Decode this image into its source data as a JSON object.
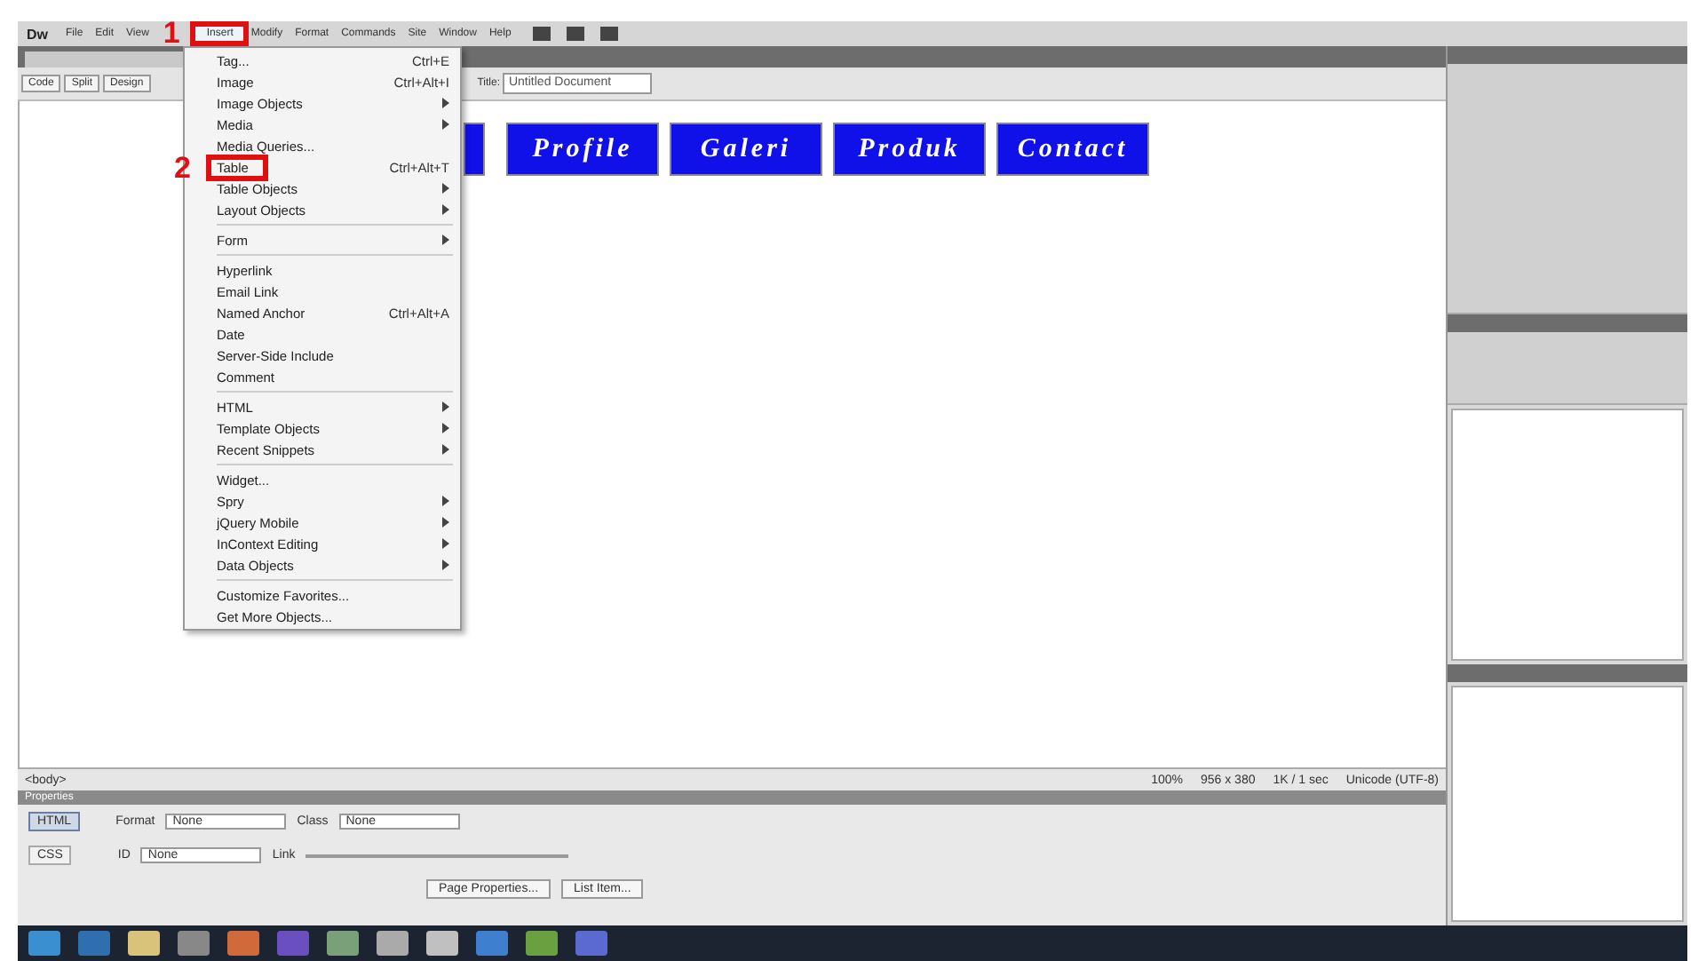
{
  "menubar": {
    "logo": "Dw",
    "items": [
      {
        "label": "File",
        "selected": false
      },
      {
        "label": "Edit",
        "selected": false
      },
      {
        "label": "View",
        "selected": false
      },
      {
        "label": "Insert",
        "selected": true,
        "annotation": "1"
      },
      {
        "label": "Modify",
        "selected": false
      },
      {
        "label": "Format",
        "selected": false
      },
      {
        "label": "Commands",
        "selected": false
      },
      {
        "label": "Site",
        "selected": false
      },
      {
        "label": "Window",
        "selected": false
      },
      {
        "label": "Help",
        "selected": false
      }
    ]
  },
  "document": {
    "view_buttons": [
      "Code",
      "Split",
      "Design"
    ],
    "title_label": "Title:",
    "title_value": "Untitled Document"
  },
  "page": {
    "nav_buttons": [
      "Profile",
      "Galeri",
      "Produk",
      "Contact"
    ]
  },
  "insert_menu": {
    "items": [
      {
        "kind": "item",
        "label": "Tag...",
        "shortcut": "Ctrl+E",
        "submenu": false
      },
      {
        "kind": "item",
        "label": "Image",
        "shortcut": "Ctrl+Alt+I",
        "submenu": false
      },
      {
        "kind": "item",
        "label": "Image Objects",
        "submenu": true
      },
      {
        "kind": "item",
        "label": "Media",
        "submenu": true
      },
      {
        "kind": "item",
        "label": "Media Queries...",
        "submenu": false
      },
      {
        "kind": "item",
        "label": "Table",
        "shortcut": "Ctrl+Alt+T",
        "submenu": false,
        "annotation": "2"
      },
      {
        "kind": "item",
        "label": "Table Objects",
        "submenu": true
      },
      {
        "kind": "item",
        "label": "Layout Objects",
        "submenu": true
      },
      {
        "kind": "separator"
      },
      {
        "kind": "item",
        "label": "Form",
        "submenu": true
      },
      {
        "kind": "separator"
      },
      {
        "kind": "item",
        "label": "Hyperlink",
        "submenu": false
      },
      {
        "kind": "item",
        "label": "Email Link",
        "submenu": false
      },
      {
        "kind": "item",
        "label": "Named Anchor",
        "shortcut": "Ctrl+Alt+A",
        "submenu": false
      },
      {
        "kind": "item",
        "label": "Date",
        "submenu": false
      },
      {
        "kind": "item",
        "label": "Server-Side Include",
        "submenu": false
      },
      {
        "kind": "item",
        "label": "Comment",
        "submenu": false
      },
      {
        "kind": "separator"
      },
      {
        "kind": "item",
        "label": "HTML",
        "submenu": true
      },
      {
        "kind": "item",
        "label": "Template Objects",
        "submenu": true
      },
      {
        "kind": "item",
        "label": "Recent Snippets",
        "submenu": true
      },
      {
        "kind": "separator"
      },
      {
        "kind": "item",
        "label": "Widget...",
        "submenu": false
      },
      {
        "kind": "item",
        "label": "Spry",
        "submenu": true
      },
      {
        "kind": "item",
        "label": "jQuery Mobile",
        "submenu": true
      },
      {
        "kind": "item",
        "label": "InContext Editing",
        "submenu": true
      },
      {
        "kind": "item",
        "label": "Data Objects",
        "submenu": true
      },
      {
        "kind": "separator"
      },
      {
        "kind": "item",
        "label": "Customize Favorites...",
        "submenu": false
      },
      {
        "kind": "item",
        "label": "Get More Objects...",
        "submenu": false
      }
    ]
  },
  "status_bar": {
    "tag": "<body>",
    "zoom": "100%",
    "size": "956 x 380",
    "download": "1K / 1 sec",
    "encoding": "Unicode (UTF-8)"
  },
  "properties": {
    "title": "Properties",
    "modes": [
      {
        "label": "HTML",
        "selected": true
      },
      {
        "label": "CSS",
        "selected": false
      }
    ],
    "format_label": "Format",
    "format_value": "None",
    "class_label": "Class",
    "class_value": "None",
    "id_label": "ID",
    "id_value": "None",
    "link_label": "Link",
    "page_properties": "Page Properties...",
    "list_item": "List Item..."
  }
}
